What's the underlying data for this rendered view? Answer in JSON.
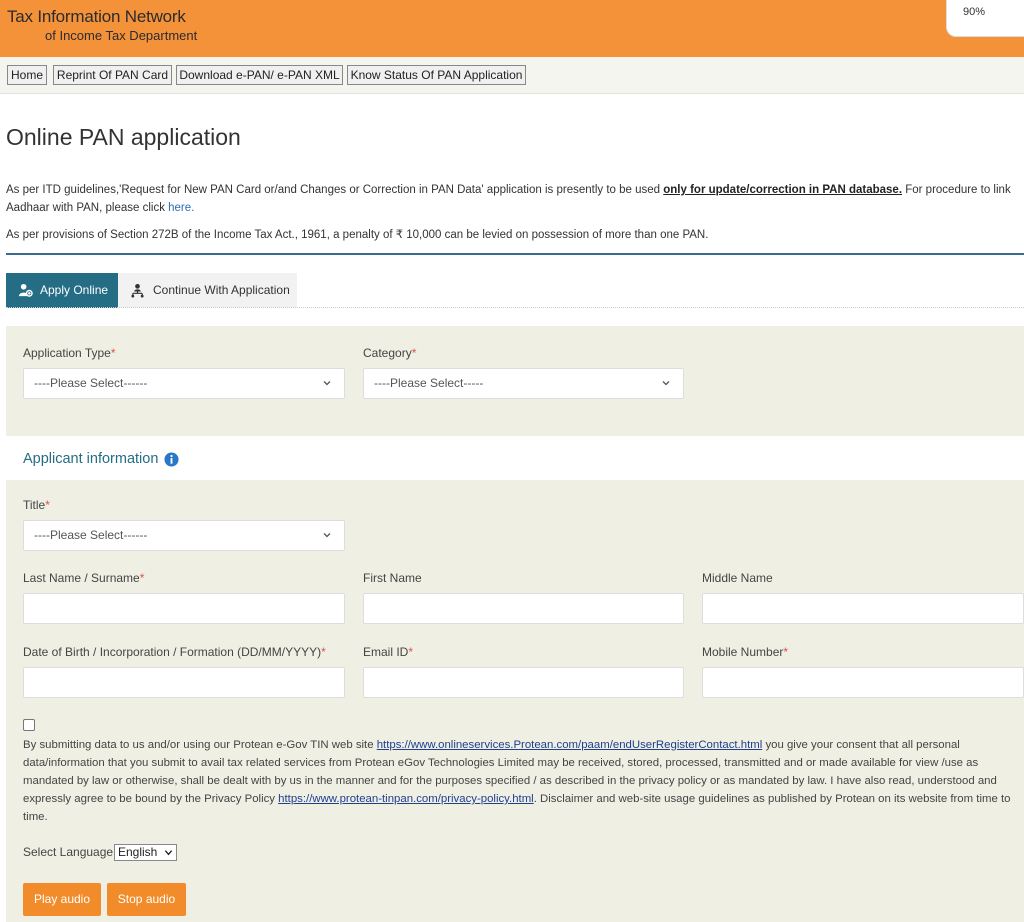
{
  "header": {
    "brand_line1": "Tax Information Network",
    "brand_line2": "of Income Tax Department",
    "zoom_level": "90%"
  },
  "nav": {
    "items": [
      "Home",
      "Reprint Of PAN Card",
      "Download e-PAN/ e-PAN XML",
      "Know Status Of PAN Application"
    ]
  },
  "page": {
    "title": "Online PAN application",
    "info1_pre": "As per ITD guidelines,'Request for New PAN Card or/and Changes or Correction in PAN Data' application is presently to be used ",
    "info1_bold": "only for update/correction in PAN database.",
    "info1_post": " For procedure to link Aadhaar with PAN, please click ",
    "info1_link": "here.",
    "info2": "As per provisions of Section 272B of the Income Tax Act., 1961, a penalty of ₹ 10,000 can be levied on possession of more than one PAN."
  },
  "tabs": {
    "apply": "Apply Online",
    "continue": "Continue With Application"
  },
  "form": {
    "application_type_label": "Application Type",
    "application_type_value": "----Please Select------",
    "category_label": "Category",
    "category_value": "----Please Select-----",
    "applicant_section_title": "Applicant information",
    "title_label": "Title",
    "title_value": "----Please Select------",
    "last_name_label": "Last Name / Surname",
    "first_name_label": "First Name",
    "middle_name_label": "Middle Name",
    "dob_label": "Date of Birth / Incorporation / Formation (DD/MM/YYYY)",
    "email_label": "Email ID",
    "mobile_label": "Mobile Number",
    "required_mark": "*"
  },
  "consent": {
    "text1": "By submitting data to us and/or using our Protean e-Gov TIN web site ",
    "link1": "https://www.onlineservices.Protean.com/paam/endUserRegisterContact.html",
    "text2": " you give your consent that all personal data/information that you submit to avail tax related services from Protean eGov Technologies Limited may be received, stored, processed, transmitted and or made available for view /use as mandated by law or otherwise, shall be dealt with by us in the manner and for the purposes specified / as described in the privacy policy or as mandated by law. I have also read, understood and expressly agree to be bound by the Privacy Policy ",
    "link2": "https://www.protean-tinpan.com/privacy-policy.html",
    "text3": ". Disclaimer and web-site usage guidelines as published by Protean on its website from time to time."
  },
  "language": {
    "label": "Select Language",
    "value": "English"
  },
  "audio": {
    "play": "Play audio",
    "stop": "Stop audio"
  },
  "colors": {
    "header_orange": "#f4923a",
    "tab_teal": "#256d85",
    "button_orange": "#f28c2a",
    "required_red": "#d9534f"
  }
}
